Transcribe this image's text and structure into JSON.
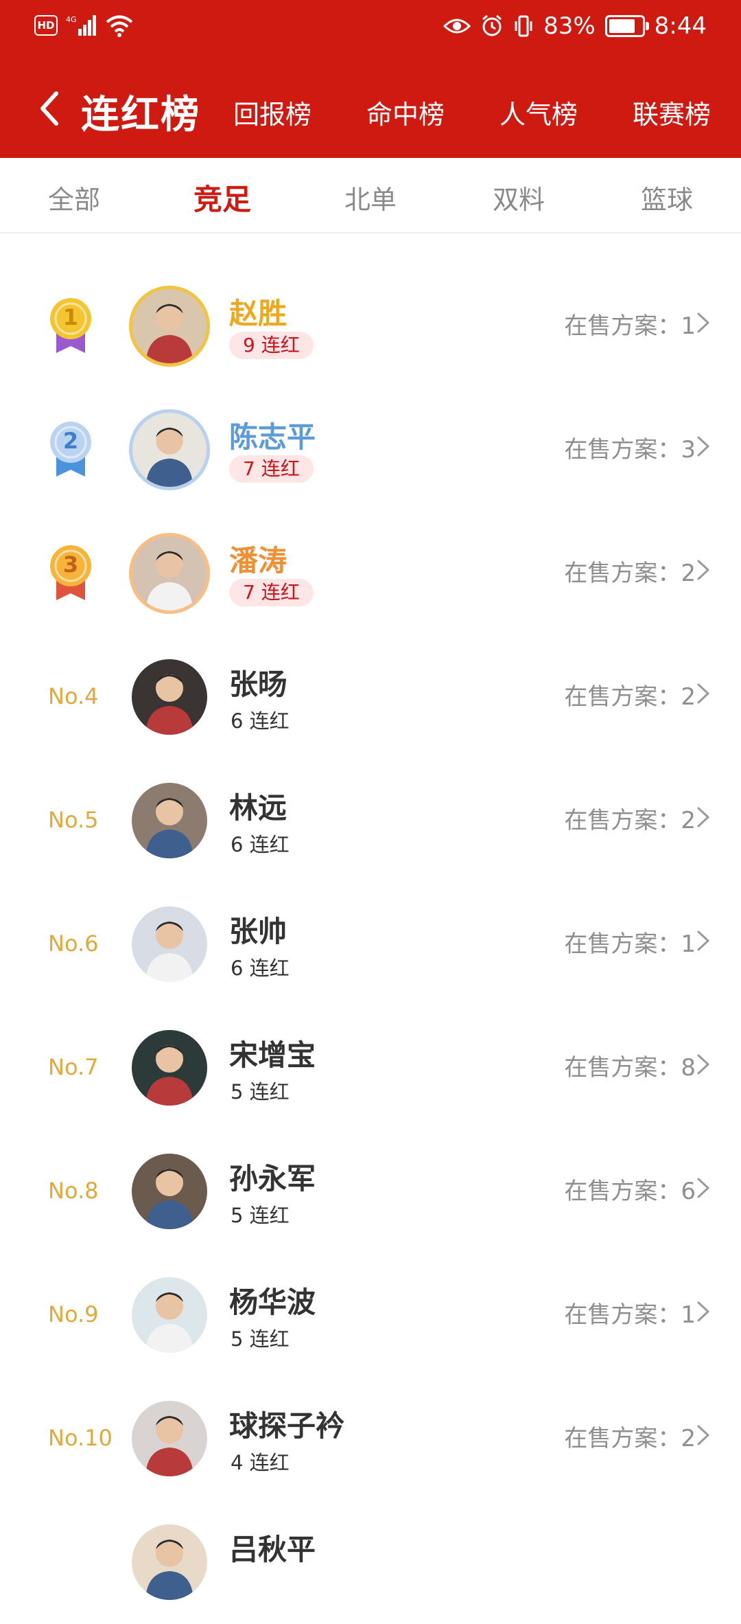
{
  "status_bar": {
    "network": "4G",
    "hd": "HD",
    "battery": "83%",
    "time": "8:44"
  },
  "header": {
    "title": "连红榜",
    "tabs": [
      "回报榜",
      "命中榜",
      "人气榜",
      "联赛榜"
    ]
  },
  "subtabs": {
    "items": [
      "全部",
      "竞足",
      "北单",
      "双料",
      "篮球"
    ],
    "active": "竞足"
  },
  "sale_label": "在售方案：",
  "list": [
    {
      "rank": "1",
      "name": "赵胜",
      "streak": "9 连红",
      "count": "1",
      "name_color": "#f0a81b",
      "ring": "#f2c443"
    },
    {
      "rank": "2",
      "name": "陈志平",
      "streak": "7 连红",
      "count": "3",
      "name_color": "#5b9bd9",
      "ring": "#b7d1ee"
    },
    {
      "rank": "3",
      "name": "潘涛",
      "streak": "7 连红",
      "count": "2",
      "name_color": "#f08f33",
      "ring": "#f7bf86"
    },
    {
      "rank": "No.4",
      "name": "张旸",
      "streak": "6 连红",
      "count": "2"
    },
    {
      "rank": "No.5",
      "name": "林远",
      "streak": "6 连红",
      "count": "2"
    },
    {
      "rank": "No.6",
      "name": "张帅",
      "streak": "6 连红",
      "count": "1"
    },
    {
      "rank": "No.7",
      "name": "宋增宝",
      "streak": "5 连红",
      "count": "8"
    },
    {
      "rank": "No.8",
      "name": "孙永军",
      "streak": "5 连红",
      "count": "6"
    },
    {
      "rank": "No.9",
      "name": "杨华波",
      "streak": "5 连红",
      "count": "1"
    },
    {
      "rank": "No.10",
      "name": "球探子衿",
      "streak": "4 连红",
      "count": "2"
    },
    {
      "rank": "",
      "name": "吕秋平",
      "streak": "",
      "count": ""
    }
  ],
  "colors": {
    "brand_red": "#cf1a12",
    "rank_gold": "#e2a93a"
  }
}
